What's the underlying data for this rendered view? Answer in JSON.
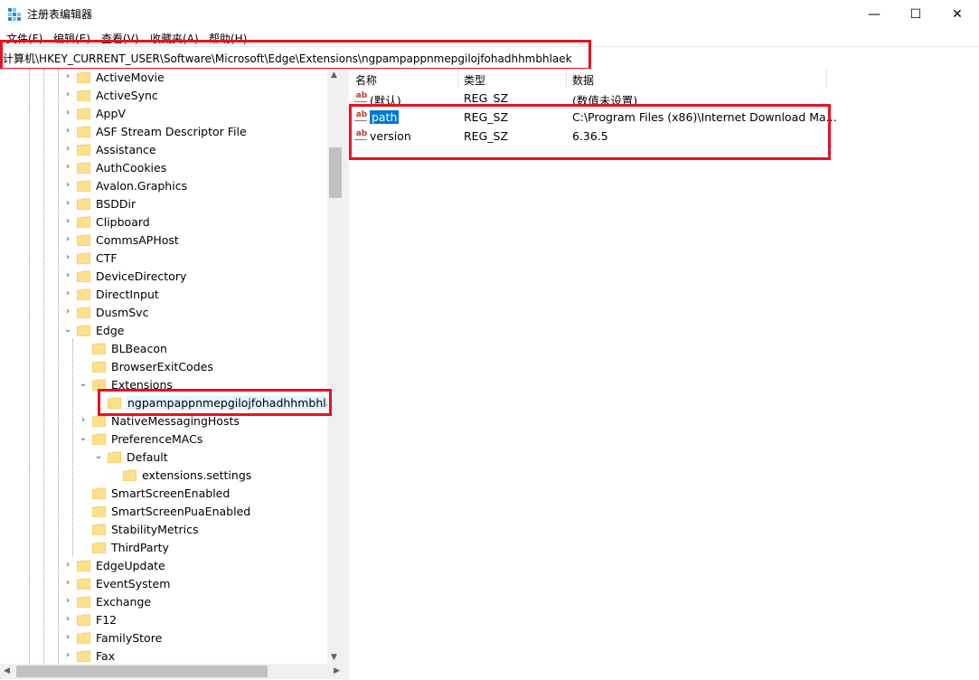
{
  "window": {
    "title": "注册表编辑器",
    "minimize_glyph": "—",
    "maximize_glyph": "☐",
    "close_glyph": "✕"
  },
  "menu": [
    "文件(F)",
    "编辑(E)",
    "查看(V)",
    "收藏夹(A)",
    "帮助(H)"
  ],
  "address": "计算机\\HKEY_CURRENT_USER\\Software\\Microsoft\\Edge\\Extensions\\ngpampappnmepgilojfohadhhmbhlaek",
  "tree": [
    {
      "label": "ActiveMovie",
      "level": 0,
      "exp": "collapsed"
    },
    {
      "label": "ActiveSync",
      "level": 0,
      "exp": "collapsed"
    },
    {
      "label": "AppV",
      "level": 0,
      "exp": "collapsed"
    },
    {
      "label": "ASF Stream Descriptor File",
      "level": 0,
      "exp": "collapsed"
    },
    {
      "label": "Assistance",
      "level": 0,
      "exp": "collapsed"
    },
    {
      "label": "AuthCookies",
      "level": 0,
      "exp": "collapsed"
    },
    {
      "label": "Avalon.Graphics",
      "level": 0,
      "exp": "collapsed"
    },
    {
      "label": "BSDDir",
      "level": 0,
      "exp": "collapsed"
    },
    {
      "label": "Clipboard",
      "level": 0,
      "exp": "collapsed"
    },
    {
      "label": "CommsAPHost",
      "level": 0,
      "exp": "collapsed"
    },
    {
      "label": "CTF",
      "level": 0,
      "exp": "collapsed"
    },
    {
      "label": "DeviceDirectory",
      "level": 0,
      "exp": "collapsed"
    },
    {
      "label": "DirectInput",
      "level": 0,
      "exp": "collapsed"
    },
    {
      "label": "DusmSvc",
      "level": 0,
      "exp": "collapsed"
    },
    {
      "label": "Edge",
      "level": 0,
      "exp": "expanded"
    },
    {
      "label": "BLBeacon",
      "level": 1,
      "exp": "none"
    },
    {
      "label": "BrowserExitCodes",
      "level": 1,
      "exp": "none"
    },
    {
      "label": "Extensions",
      "level": 1,
      "exp": "expanded"
    },
    {
      "label": "ngpampappnmepgilojfohadhhmbhlaek",
      "level": 2,
      "exp": "none",
      "selected": true
    },
    {
      "label": "NativeMessagingHosts",
      "level": 1,
      "exp": "collapsed"
    },
    {
      "label": "PreferenceMACs",
      "level": 1,
      "exp": "expanded"
    },
    {
      "label": "Default",
      "level": 2,
      "exp": "expanded"
    },
    {
      "label": "extensions.settings",
      "level": 3,
      "exp": "none"
    },
    {
      "label": "SmartScreenEnabled",
      "level": 1,
      "exp": "none"
    },
    {
      "label": "SmartScreenPuaEnabled",
      "level": 1,
      "exp": "none"
    },
    {
      "label": "StabilityMetrics",
      "level": 1,
      "exp": "none"
    },
    {
      "label": "ThirdParty",
      "level": 1,
      "exp": "none"
    },
    {
      "label": "EdgeUpdate",
      "level": 0,
      "exp": "collapsed"
    },
    {
      "label": "EventSystem",
      "level": 0,
      "exp": "collapsed"
    },
    {
      "label": "Exchange",
      "level": 0,
      "exp": "collapsed"
    },
    {
      "label": "F12",
      "level": 0,
      "exp": "collapsed"
    },
    {
      "label": "FamilyStore",
      "level": 0,
      "exp": "collapsed"
    },
    {
      "label": "Fax",
      "level": 0,
      "exp": "collapsed"
    }
  ],
  "columns": {
    "name": "名称",
    "type": "类型",
    "data": "数据"
  },
  "values": [
    {
      "icon": "ab",
      "name": "(默认)",
      "type": "REG_SZ",
      "data": "(数值未设置)"
    },
    {
      "icon": "ab",
      "name": "path",
      "type": "REG_SZ",
      "data": "C:\\Program Files (x86)\\Internet Download Ma...",
      "selected": true
    },
    {
      "icon": "ab",
      "name": "version",
      "type": "REG_SZ",
      "data": "6.36.5"
    }
  ],
  "colors": {
    "highlight": "#e81123",
    "selection": "#cce8ff",
    "folder": "#ffe08a"
  }
}
